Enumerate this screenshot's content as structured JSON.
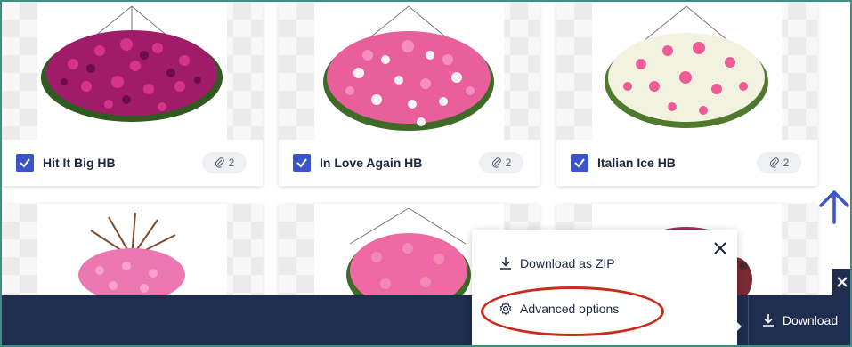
{
  "cards": [
    {
      "title": "Hit It Big HB",
      "count": "2",
      "flower": "#a01c6a",
      "flower2": "#d6338c",
      "leaf": "#2f5a20"
    },
    {
      "title": "In Love Again HB",
      "count": "2",
      "flower": "#e85f9c",
      "flower2": "#f7f3f5",
      "leaf": "#3e6b27"
    },
    {
      "title": "Italian Ice HB",
      "count": "2",
      "flower": "#ef5c95",
      "flower2": "#f1f2df",
      "leaf": "#4f7a2e"
    }
  ],
  "cards_row2": [
    {
      "flower": "#ec78b2",
      "flower2": "#7c4b2b",
      "leaf": "#3e6b27"
    },
    {
      "flower": "#ef6aa5",
      "flower2": "#f28ab8",
      "leaf": "#3e6b27"
    },
    {
      "flower": "#b02660",
      "flower2": "#7a2a35",
      "leaf": "#4a2a2e"
    }
  ],
  "popup": {
    "download_zip_label": "Download as ZIP",
    "advanced_options_label": "Advanced options"
  },
  "bottom_bar": {
    "download_label": "Download"
  },
  "colors": {
    "accent": "#3b55c9",
    "bar": "#1f2d4f",
    "highlight": "#c92a1a"
  }
}
